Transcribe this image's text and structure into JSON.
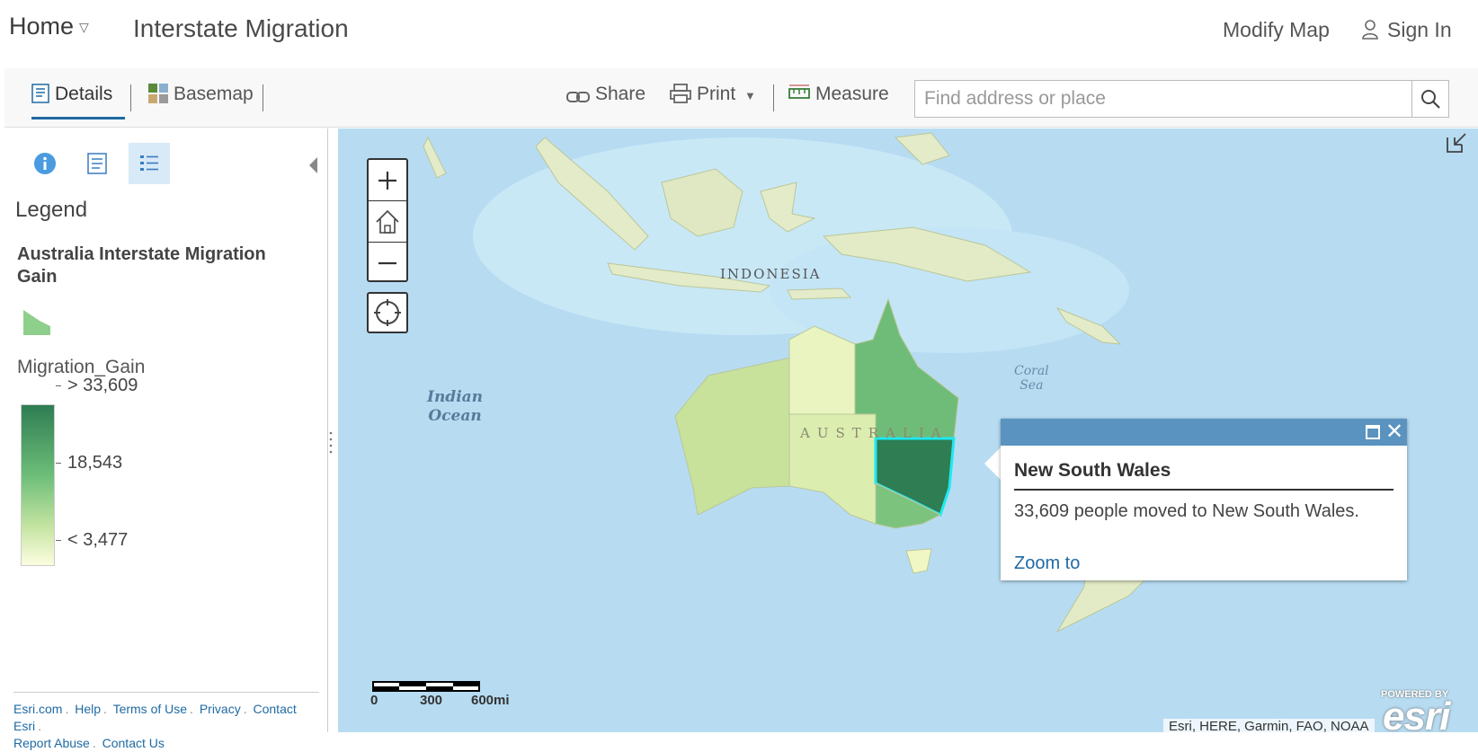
{
  "header": {
    "home_label": "Home",
    "title": "Interstate Migration",
    "modify_map": "Modify Map",
    "sign_in": "Sign In"
  },
  "toolbar": {
    "details": "Details",
    "basemap": "Basemap",
    "share": "Share",
    "print": "Print",
    "measure": "Measure",
    "search_placeholder": "Find address or place"
  },
  "legend": {
    "heading": "Legend",
    "layer_title": "Australia Interstate Migration Gain",
    "field": "Migration_Gain",
    "high_label": "> 33,609",
    "mid_label": "18,543",
    "low_label": "< 3,477",
    "ramp_colors": [
      "#2e7d53",
      "#6fbf7a",
      "#c2e3a0",
      "#fdfde0"
    ],
    "swatch_color": "#8fcf8c"
  },
  "footer": {
    "links": [
      "Esri.com",
      "Help",
      "Terms of Use",
      "Privacy",
      "Contact Esri",
      "Report Abuse",
      "Contact Us"
    ]
  },
  "map": {
    "labels": {
      "indonesia": "INDONESIA",
      "australia": "AUSTRALIA",
      "indian_ocean_1": "Indian",
      "indian_ocean_2": "Ocean",
      "coral_sea_1": "Coral",
      "coral_sea_2": "Sea"
    },
    "region_colors": {
      "western_australia": "#c8e29c",
      "northern_territory": "#eaf4c0",
      "south_australia": "#dcedb0",
      "queensland": "#6fbc78",
      "new_south_wales": "#2e7d53",
      "victoria": "#7cc47e",
      "tasmania": "#f1f7c4",
      "selection": "#1de9f0"
    },
    "scalebar": {
      "label_0": "0",
      "label_1": "300",
      "label_2": "600mi"
    },
    "attribution": "Esri, HERE, Garmin, FAO, NOAA",
    "esri_powered": "POWERED BY",
    "esri_word": "esri"
  },
  "popup": {
    "title": "New South Wales",
    "body": "33,609 people moved to New South Wales.",
    "zoom_to": "Zoom to"
  }
}
